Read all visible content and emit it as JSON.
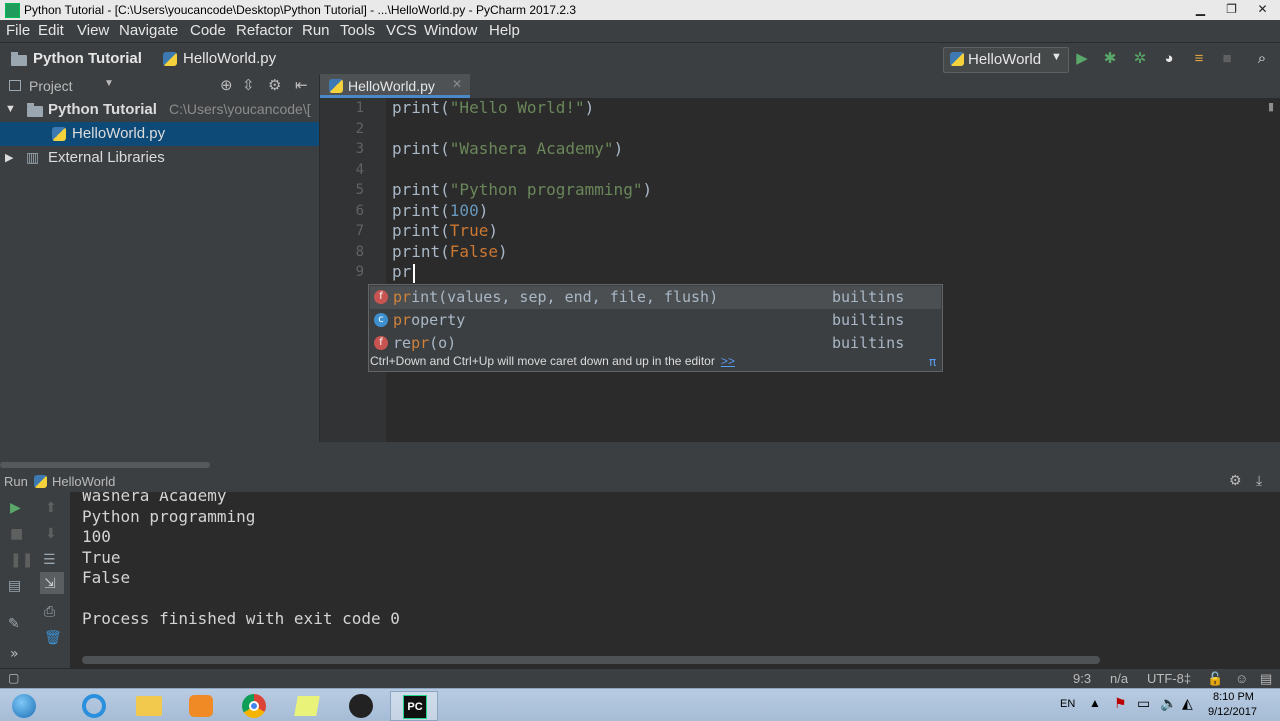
{
  "window": {
    "title": "Python Tutorial - [C:\\Users\\youcancode\\Desktop\\Python Tutorial] - ...\\HelloWorld.py - PyCharm 2017.2.3"
  },
  "menu": [
    "File",
    "Edit",
    "View",
    "Navigate",
    "Code",
    "Refactor",
    "Run",
    "Tools",
    "VCS",
    "Window",
    "Help"
  ],
  "navbar": {
    "project": "Python Tutorial",
    "file": "HelloWorld.py",
    "run_config": "HelloWorld"
  },
  "project_panel": {
    "title": "Project",
    "root_name": "Python Tutorial",
    "root_path": "C:\\Users\\youcancode\\[",
    "file": "HelloWorld.py",
    "libraries": "External Libraries"
  },
  "editor": {
    "tab": "HelloWorld.py",
    "line_numbers": [
      "1",
      "2",
      "3",
      "4",
      "5",
      "6",
      "7",
      "8",
      "9"
    ],
    "lines": {
      "l1_fn": "print(",
      "l1_str": "\"Hello World!\"",
      "l1_end": ")",
      "l3_fn": "print(",
      "l3_str": "\"Washera Academy\"",
      "l3_end": ")",
      "l5_fn": "print(",
      "l5_str": "\"Python programming\"",
      "l5_end": ")",
      "l6_fn": "print(",
      "l6_num": "100",
      "l6_end": ")",
      "l7_fn": "print(",
      "l7_kw": "True",
      "l7_end": ")",
      "l8_fn": "print(",
      "l8_kw": "False",
      "l8_end": ")",
      "l9": "pr"
    }
  },
  "completion": {
    "items": [
      {
        "icon": "f",
        "match": "pr",
        "rest": "int(values, sep, end, file, flush)",
        "source": "builtins"
      },
      {
        "icon": "c",
        "match": "pr",
        "rest": "operty",
        "source": "builtins"
      },
      {
        "icon": "f",
        "prefix": "re",
        "match": "pr",
        "rest": "(o)",
        "source": "builtins"
      }
    ],
    "footer": "Ctrl+Down and Ctrl+Up will move caret down and up in the editor",
    "footer_link": ">>",
    "footer_pi": "π"
  },
  "run_panel": {
    "label": "Run",
    "config": "HelloWorld",
    "output": [
      "Washera Academy",
      "Python programming",
      "100",
      "True",
      "False",
      "",
      "Process finished with exit code 0"
    ]
  },
  "statusbar": {
    "position": "9:3",
    "na": "n/a",
    "encoding": "UTF-8‡"
  },
  "taskbar": {
    "lang": "EN",
    "time": "8:10 PM",
    "date": "9/12/2017"
  }
}
